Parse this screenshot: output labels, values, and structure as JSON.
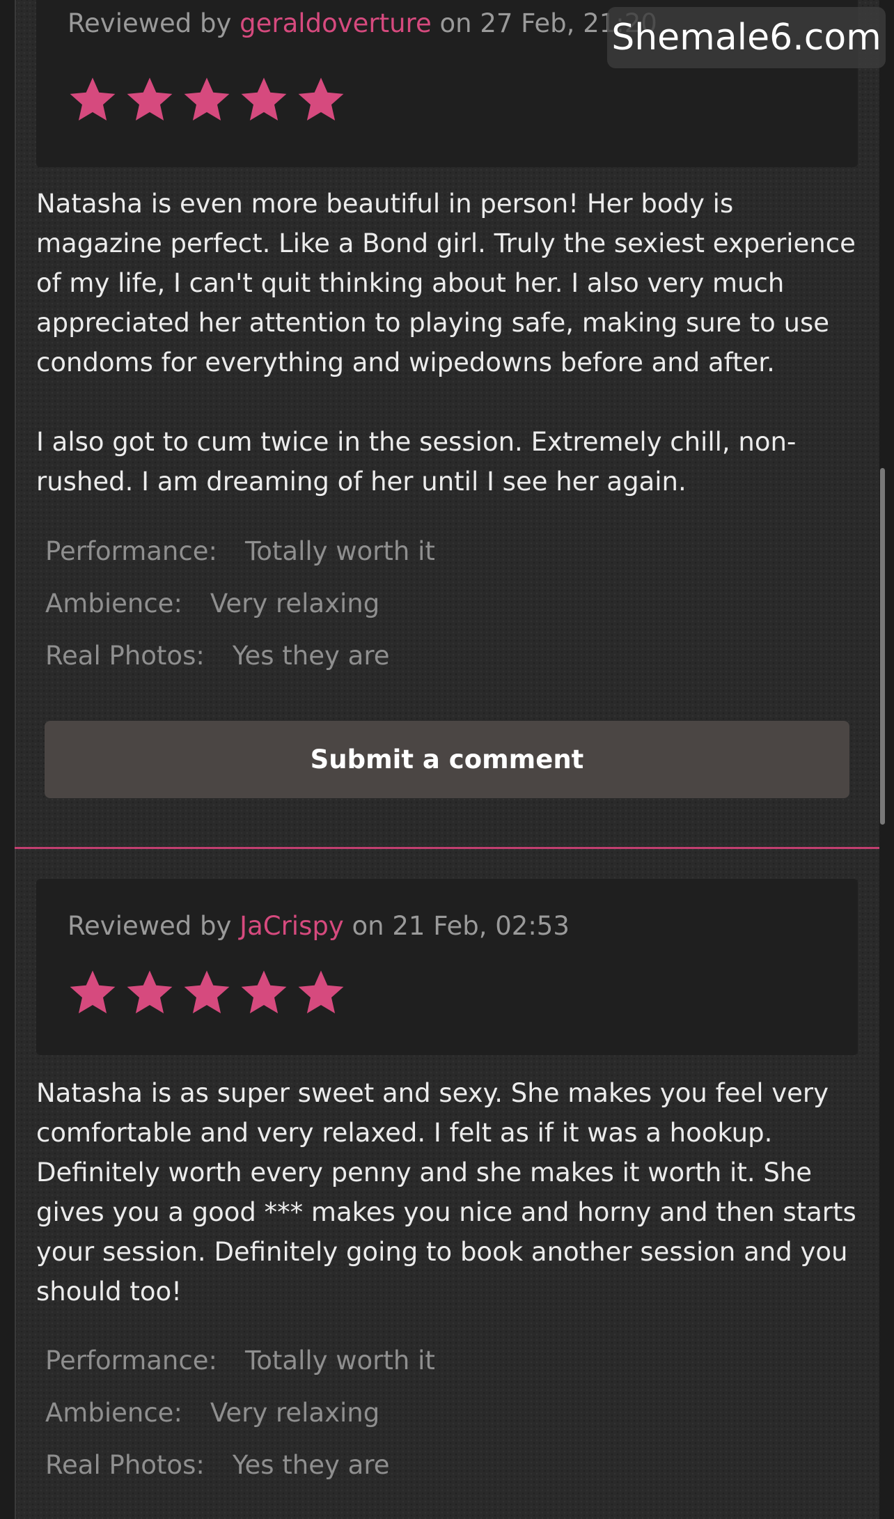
{
  "watermark": "Shemale6.com",
  "colors": {
    "accent": "#d64a7e",
    "star": "#d64a7e",
    "divider": "#c23f70",
    "button": "#4b4644"
  },
  "reviews": [
    {
      "reviewed_by_label": "Reviewed by",
      "reviewer": "geraldoverture",
      "date": "on 27 Feb, 21:20",
      "stars": 5,
      "paragraphs": [
        "Natasha is even more beautiful in person! Her body is magazine perfect. Like a Bond girl. Truly the sexiest experience of my life, I can't quit thinking about her. I also very much appreciated her attention to playing safe, making sure to use condoms for everything and wipedowns before and after.",
        "I also got to cum twice in the session. Extremely chill, non-rushed. I am dreaming of her until I see her again."
      ],
      "ratings": [
        {
          "label": "Performance:",
          "value": "Totally worth it"
        },
        {
          "label": "Ambience:",
          "value": "Very relaxing"
        },
        {
          "label": "Real Photos:",
          "value": "Yes they are"
        }
      ],
      "comment_button": "Submit a comment"
    },
    {
      "reviewed_by_label": "Reviewed by",
      "reviewer": "JaCrispy",
      "date": "on 21 Feb, 02:53",
      "stars": 5,
      "paragraphs": [
        "Natasha is as super sweet and sexy. She makes you feel very comfortable and very relaxed. I felt as if it was a hookup. Definitely worth every penny and she makes it worth it. She gives you a good *** makes you nice and horny and then starts your session. Definitely going to book another session and you should too!"
      ],
      "ratings": [
        {
          "label": "Performance:",
          "value": "Totally worth it"
        },
        {
          "label": "Ambience:",
          "value": "Very relaxing"
        },
        {
          "label": "Real Photos:",
          "value": "Yes they are"
        }
      ]
    }
  ]
}
